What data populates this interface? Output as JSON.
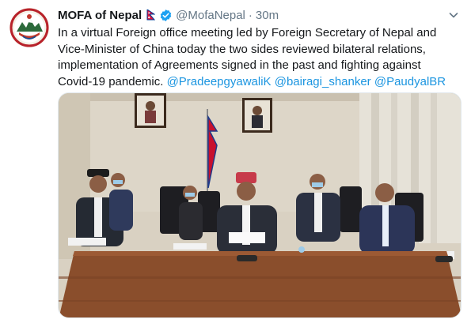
{
  "tweet": {
    "author_name": "MOFA of Nepal",
    "handle": "@MofaNepal",
    "separator": "·",
    "time": "30m",
    "text_lines": [
      "In a virtual Foreign office meeting led by Foreign Secretary of Nepal and",
      "Vice-Minister of China today the two sides reviewed bilateral relations,",
      "implementation of Agreements signed in the past and fighting against",
      "Covid-19 pandemic."
    ],
    "mentions": [
      "@PradeepgyawaliK",
      "@bairagi_shanker",
      "@PaudyalBR"
    ],
    "icons": {
      "avatar": "mofa-logo-icon",
      "flag": "nepal-flag-icon",
      "verified": "verified-badge-icon",
      "menu": "chevron-down-icon"
    },
    "colors": {
      "verified": "#1da1f2",
      "mention": "#1b95e0",
      "muted": "#657786"
    }
  }
}
